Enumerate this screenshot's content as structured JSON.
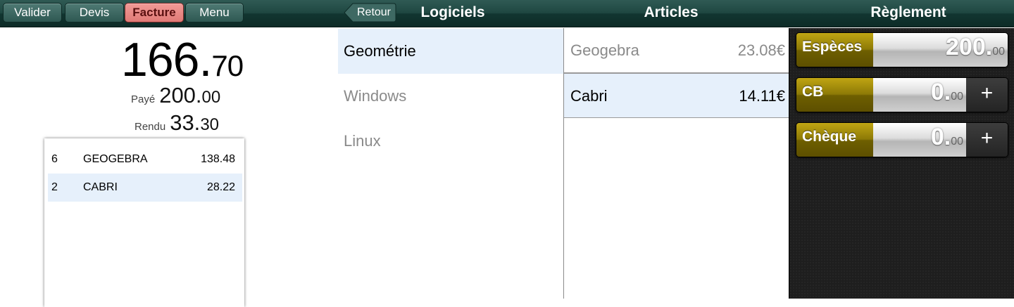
{
  "toolbar": {
    "valider": "Valider",
    "devis": "Devis",
    "facture": "Facture",
    "menu": "Menu",
    "back": "Retour",
    "active_button": "Facture",
    "active_color": "#f19a96"
  },
  "titles": {
    "logiciels": "Logiciels",
    "articles": "Articles",
    "reglement": "Règlement"
  },
  "totals": {
    "total_int": "166.",
    "total_dec": "70",
    "paid_label": "Payé",
    "paid_int": "200.",
    "paid_dec": "00",
    "change_label": "Rendu",
    "change_int": "33.",
    "change_dec": "30"
  },
  "receipt": {
    "lines": [
      {
        "qty": "6",
        "name": "GEOGEBRA",
        "amount": "138.48"
      },
      {
        "qty": "2",
        "name": "CABRI",
        "amount": "28.22"
      }
    ]
  },
  "categories": [
    {
      "label": "Geométrie",
      "selected": true
    },
    {
      "label": "Windows",
      "selected": false
    },
    {
      "label": "Linux",
      "selected": false
    }
  ],
  "articles": [
    {
      "name": "Geogebra",
      "price": "23.08€",
      "selected": false
    },
    {
      "name": "Cabri",
      "price": "14.11€",
      "selected": true
    }
  ],
  "payments": [
    {
      "label": "Espèces",
      "int": "200.",
      "dec": "00",
      "has_plus": false
    },
    {
      "label": "CB",
      "int": "0.",
      "dec": "00",
      "has_plus": true
    },
    {
      "label": "Chèque",
      "int": "0.",
      "dec": "00",
      "has_plus": true
    }
  ],
  "plus_symbol": "+",
  "colors": {
    "toolbar": "#1e4640",
    "selected_row": "#e6f0fb",
    "payment_label": "#8d7a06"
  }
}
